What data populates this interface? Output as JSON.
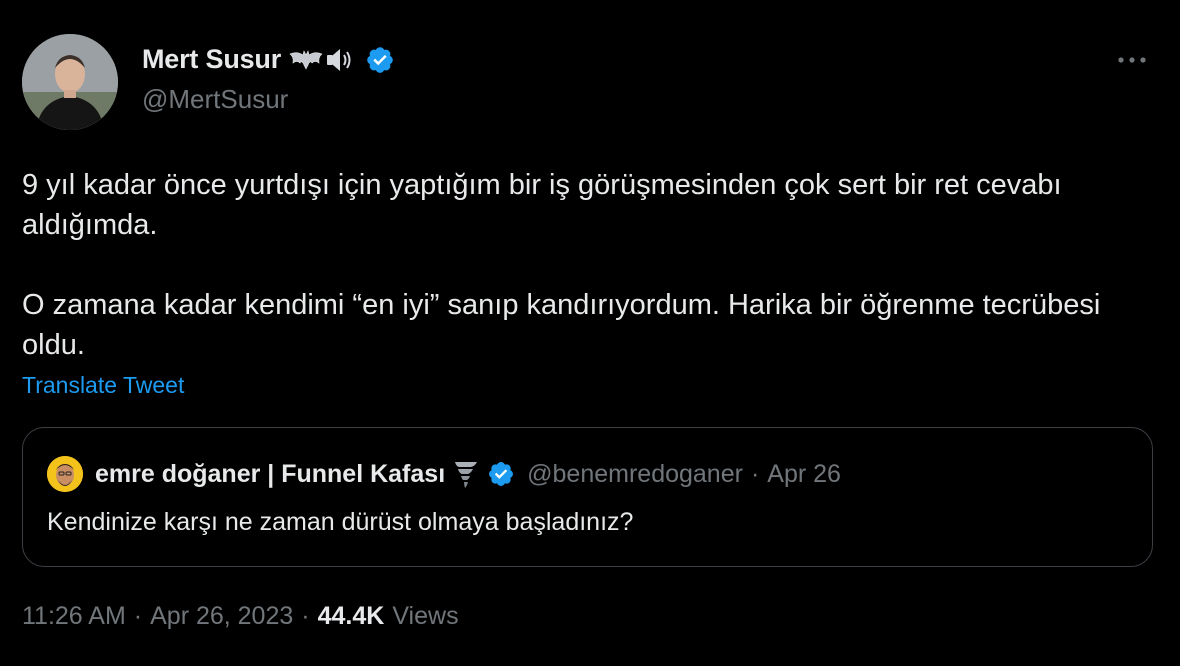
{
  "author": {
    "display_name": "Mert Susur",
    "name_emojis": [
      "bat-icon",
      "speaker-icon"
    ],
    "verified": true,
    "handle": "@MertSusur"
  },
  "tweet": {
    "paragraphs": [
      "9 yıl kadar önce yurtdışı için yaptığım bir iş görüşmesinden çok sert bir ret cevabı aldığımda.",
      "O zamana kadar kendimi “en iyi” sanıp kandırıyordum. Harika bir öğrenme tecrübesi oldu."
    ],
    "translate_label": "Translate Tweet"
  },
  "quoted_tweet": {
    "display_name": "emre doğaner | Funnel Kafası",
    "name_emoji": "tornado-icon",
    "verified": true,
    "handle": "@benemredoganer",
    "separator": "·",
    "date": "Apr 26",
    "text": "Kendinize karşı ne zaman dürüst olmaya başladınız?"
  },
  "meta": {
    "time": "11:26 AM",
    "separator": "·",
    "date": "Apr 26, 2023",
    "views_count": "44.4K",
    "views_label": "Views"
  },
  "colors": {
    "background": "#000000",
    "text": "#e7e9ea",
    "muted": "#71767b",
    "accent": "#1d9bf0",
    "border": "#3b3f44"
  }
}
